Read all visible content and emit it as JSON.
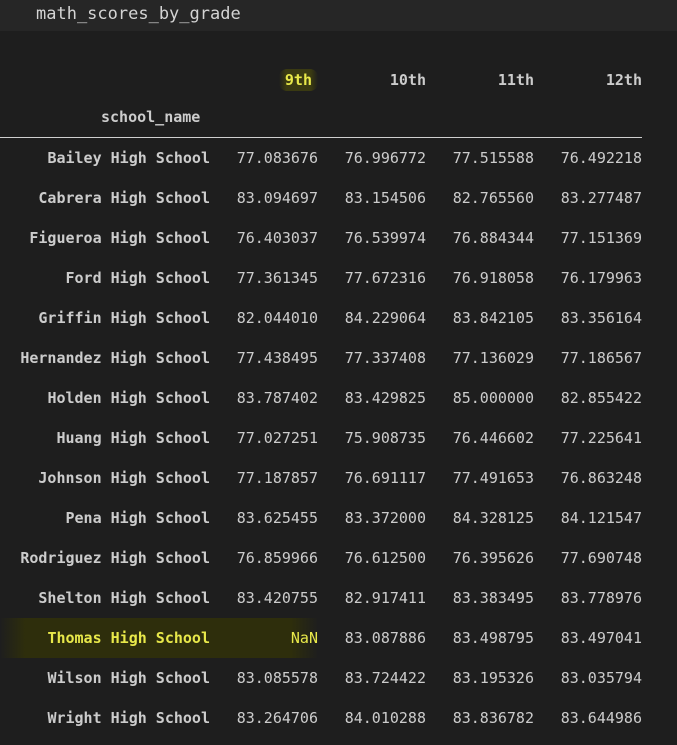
{
  "code_cell": {
    "text": "math_scores_by_grade"
  },
  "table": {
    "columns": [
      "9th",
      "10th",
      "11th",
      "12th"
    ],
    "index_name": "school_name",
    "rows": [
      {
        "name": "Bailey High School",
        "values": [
          "77.083676",
          "76.996772",
          "77.515588",
          "76.492218"
        ]
      },
      {
        "name": "Cabrera High School",
        "values": [
          "83.094697",
          "83.154506",
          "82.765560",
          "83.277487"
        ]
      },
      {
        "name": "Figueroa High School",
        "values": [
          "76.403037",
          "76.539974",
          "76.884344",
          "77.151369"
        ]
      },
      {
        "name": "Ford High School",
        "values": [
          "77.361345",
          "77.672316",
          "76.918058",
          "76.179963"
        ]
      },
      {
        "name": "Griffin High School",
        "values": [
          "82.044010",
          "84.229064",
          "83.842105",
          "83.356164"
        ]
      },
      {
        "name": "Hernandez High School",
        "values": [
          "77.438495",
          "77.337408",
          "77.136029",
          "77.186567"
        ]
      },
      {
        "name": "Holden High School",
        "values": [
          "83.787402",
          "83.429825",
          "85.000000",
          "82.855422"
        ]
      },
      {
        "name": "Huang High School",
        "values": [
          "77.027251",
          "75.908735",
          "76.446602",
          "77.225641"
        ]
      },
      {
        "name": "Johnson High School",
        "values": [
          "77.187857",
          "76.691117",
          "77.491653",
          "76.863248"
        ]
      },
      {
        "name": "Pena High School",
        "values": [
          "83.625455",
          "83.372000",
          "84.328125",
          "84.121547"
        ]
      },
      {
        "name": "Rodriguez High School",
        "values": [
          "76.859966",
          "76.612500",
          "76.395626",
          "77.690748"
        ]
      },
      {
        "name": "Shelton High School",
        "values": [
          "83.420755",
          "82.917411",
          "83.383495",
          "83.778976"
        ]
      },
      {
        "name": "Thomas High School",
        "values": [
          "NaN",
          "83.087886",
          "83.498795",
          "83.497041"
        ]
      },
      {
        "name": "Wilson High School",
        "values": [
          "83.085578",
          "83.724422",
          "83.195326",
          "83.035794"
        ]
      },
      {
        "name": "Wright High School",
        "values": [
          "83.264706",
          "84.010288",
          "83.836782",
          "83.644986"
        ]
      }
    ]
  },
  "colors": {
    "background": "#1e1e1e",
    "code_cell_background": "#262626",
    "text": "#cccccc",
    "highlight_text": "#e8e84a"
  }
}
